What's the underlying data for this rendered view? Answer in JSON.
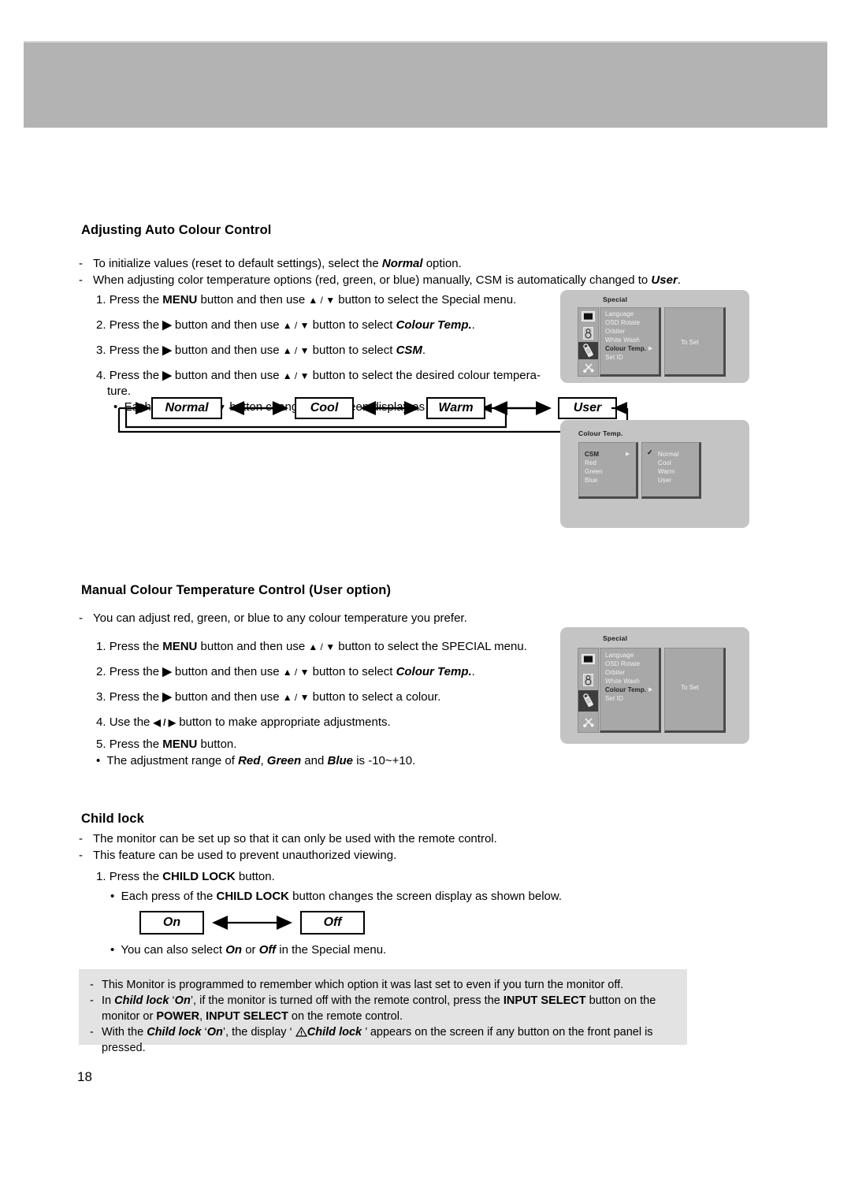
{
  "page": {
    "number": "18"
  },
  "section1": {
    "title": "Adjusting Auto Colour Control",
    "notes": [
      {
        "pre": "To initialize values (reset to default settings), select the ",
        "em": "Normal",
        "post": " option."
      },
      {
        "pre": "When adjusting color temperature options (red, green, or blue) manually, CSM is automatically changed to ",
        "em": "User",
        "post": "."
      }
    ],
    "steps": [
      {
        "num": "1.",
        "a": "Press the ",
        "b": "MENU",
        "c": " button and then use ",
        "arrows": "▲ / ▼",
        "d": " button to select the Special menu."
      },
      {
        "num": "2.",
        "a": "Press the ",
        "b": "▶",
        "c": " button and then use ",
        "arrows": "▲ / ▼",
        "d": " button to select ",
        "em": "Colour Temp.",
        "post": "."
      },
      {
        "num": "3.",
        "a": "Press the ",
        "b": "▶",
        "c": " button and then use ",
        "arrows": "▲ / ▼",
        "d": " button to select ",
        "em": "CSM",
        "post": "."
      },
      {
        "num": "4.",
        "a": "Press the ",
        "b": "▶",
        "c": " button and then use ",
        "arrows": "▲ / ▼",
        "d": " button to select the desired colour tempera-"
      }
    ],
    "step4_wrap": "ture.",
    "bullet": {
      "pre": "Each press of ",
      "arrows": "▲ / ▼",
      "post": " button changes the screen display as shown."
    },
    "flow_boxes": [
      "Normal",
      "Cool",
      "Warm",
      "User"
    ]
  },
  "section2": {
    "title": "Manual Colour Temperature Control (User option)",
    "notes": [
      {
        "pre": "You can adjust red, green, or blue to any colour temperature you prefer.",
        "em": "",
        "post": ""
      }
    ],
    "steps": [
      {
        "num": "1.",
        "a": "Press the ",
        "b": "MENU",
        "c": " button and then use ",
        "arrows": "▲ / ▼",
        "d": " button to select the SPECIAL menu."
      },
      {
        "num": "2.",
        "a": "Press the ",
        "b": "▶",
        "c": " button and then use ",
        "arrows": "▲ / ▼",
        "d": " button to select ",
        "em": "Colour Temp.",
        "post": "."
      },
      {
        "num": "3.",
        "a": "Press the ",
        "b": "▶",
        "c": " button and then use ",
        "arrows": "▲ / ▼",
        "d": " button to select a colour."
      },
      {
        "num": "4.",
        "a": "Use the ",
        "b": "◀ / ▶",
        "c": " button to make appropriate adjustments."
      },
      {
        "num": "5.",
        "a": "Press the ",
        "b": "MENU",
        "c": " button."
      }
    ],
    "bullet": {
      "pre": "The adjustment range of ",
      "em1": "Red",
      "mid1": ", ",
      "em2": "Green",
      "mid2": " and ",
      "em3": "Blue",
      "post": " is -10~+10."
    }
  },
  "section3": {
    "title": "Child lock",
    "notes": [
      "The monitor can be set up so that it can only be used with the remote control.",
      "This feature can be used to prevent unauthorized viewing."
    ],
    "steps": [
      {
        "num": "1.",
        "a": "Press the ",
        "b": "CHILD LOCK",
        "c": " button."
      }
    ],
    "bullet1": {
      "pre": "Each press of the ",
      "b": "CHILD LOCK",
      "post": " button changes the screen display as shown below."
    },
    "flow_boxes": [
      "On",
      "Off"
    ],
    "bullet2": {
      "pre": "You can also select ",
      "em1": "On",
      "mid": " or ",
      "em2": "Off",
      "post": " in the Special menu."
    }
  },
  "note_box": {
    "lines": [
      {
        "dash": "-",
        "parts": [
          {
            "t": "This Monitor is programmed to remember which option it was last set to even if you turn the monitor off.",
            "s": "n"
          }
        ]
      },
      {
        "dash": "-",
        "parts": [
          {
            "t": "In ",
            "s": "n"
          },
          {
            "t": "Child lock",
            "s": "bi"
          },
          {
            "t": " ‘",
            "s": "n"
          },
          {
            "t": "On",
            "s": "bi"
          },
          {
            "t": "’, if the monitor is turned off with the remote control, press the ",
            "s": "n"
          },
          {
            "t": "INPUT SELECT",
            "s": "b"
          },
          {
            "t": " button on the",
            "s": "n"
          }
        ]
      },
      {
        "dash": "",
        "parts": [
          {
            "t": "monitor or ",
            "s": "n"
          },
          {
            "t": "POWER",
            "s": "b"
          },
          {
            "t": ", ",
            "s": "n"
          },
          {
            "t": "INPUT SELECT",
            "s": "b"
          },
          {
            "t": " on the remote control.",
            "s": "n"
          }
        ]
      },
      {
        "dash": "-",
        "parts": [
          {
            "t": "With the ",
            "s": "n"
          },
          {
            "t": "Child lock",
            "s": "bi"
          },
          {
            "t": " ‘",
            "s": "n"
          },
          {
            "t": "On",
            "s": "bi"
          },
          {
            "t": "’, the display ‘ ",
            "s": "n"
          },
          {
            "t": "⚠",
            "s": "icon"
          },
          {
            "t": "Child lock",
            "s": "bi"
          },
          {
            "t": " ’ appears on the screen if any button on the front panel is",
            "s": "n"
          }
        ]
      },
      {
        "dash": "",
        "parts": [
          {
            "t": "pressed.",
            "s": "n"
          }
        ]
      }
    ]
  },
  "osd_special": {
    "title": "Special",
    "icons": [
      "picture-icon",
      "sound-icon",
      "special-remote-icon",
      "screen-tool-icon"
    ],
    "selected_icon_index": 2,
    "items": [
      "Language",
      "OSD Rotate",
      "Orbiter",
      "White Wash",
      "Colour Temp.",
      "Set ID"
    ],
    "highlighted_item": "Colour Temp.",
    "arrow": "▶",
    "right_panel_label": "To Set"
  },
  "osd_colour_temp": {
    "title": "Colour Temp.",
    "items": [
      "CSM",
      "Red",
      "Green",
      "Blue"
    ],
    "highlighted_item": "CSM",
    "arrow": "▶",
    "options": [
      "Normal",
      "Cool",
      "Warm",
      "User"
    ],
    "checked_option": "Normal",
    "check_glyph": "✓"
  },
  "colors": {
    "header_band": "#b3b3b3",
    "osd_bg": "#c4c4c4",
    "osd_panel": "#a8a8a8",
    "osd_selected": "#3d3d3d",
    "note_bg": "#e3e3e3"
  }
}
